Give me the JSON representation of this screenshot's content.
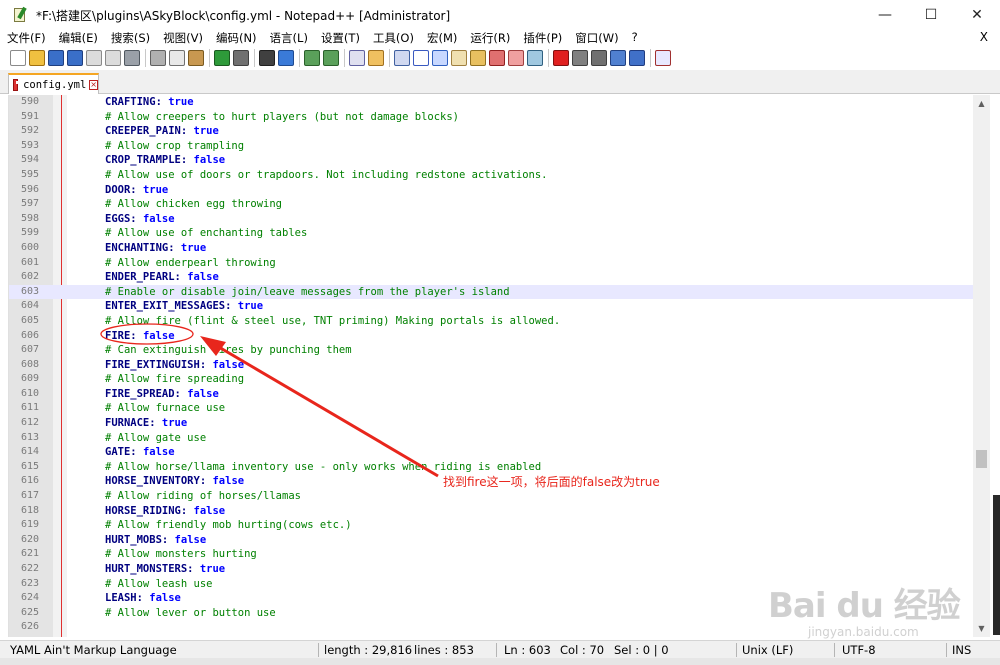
{
  "window": {
    "title": "*F:\\搭建区\\plugins\\ASkyBlock\\config.yml - Notepad++ [Administrator]",
    "controls": {
      "minimize": "—",
      "maximize": "☐",
      "close": "✕"
    }
  },
  "menu": {
    "items": [
      "文件(F)",
      "编辑(E)",
      "搜索(S)",
      "视图(V)",
      "编码(N)",
      "语言(L)",
      "设置(T)",
      "工具(O)",
      "宏(M)",
      "运行(R)",
      "插件(P)",
      "窗口(W)",
      "?"
    ],
    "close_doc": "X"
  },
  "toolbar": {
    "buttons": [
      {
        "name": "new-file-icon",
        "color": "#ffffff",
        "border": "#8a8a8a"
      },
      {
        "name": "open-file-icon",
        "color": "#f0c040",
        "border": "#a07010"
      },
      {
        "name": "save-icon",
        "color": "#3a6fc8",
        "border": "#1f3f80"
      },
      {
        "name": "save-all-icon",
        "color": "#3a6fc8",
        "border": "#1f3f80"
      },
      {
        "name": "close-file-icon",
        "color": "#dcdcdc",
        "border": "#8a8a8a"
      },
      {
        "name": "close-all-icon",
        "color": "#dcdcdc",
        "border": "#8a8a8a"
      },
      {
        "name": "print-icon",
        "color": "#9aa0a8",
        "border": "#505860"
      },
      {
        "sep": true
      },
      {
        "name": "cut-icon",
        "color": "#b0b0b0",
        "border": "#606060"
      },
      {
        "name": "copy-icon",
        "color": "#e8e8e8",
        "border": "#707070"
      },
      {
        "name": "paste-icon",
        "color": "#c89850",
        "border": "#7a5a20"
      },
      {
        "sep": true
      },
      {
        "name": "undo-icon",
        "color": "#2e9a3a",
        "border": "#1a5a20"
      },
      {
        "name": "redo-icon",
        "color": "#707070",
        "border": "#404040"
      },
      {
        "sep": true
      },
      {
        "name": "find-icon",
        "color": "#404040",
        "border": "#202020"
      },
      {
        "name": "replace-icon",
        "color": "#3a7ad8",
        "border": "#1f4a90"
      },
      {
        "sep": true
      },
      {
        "name": "zoom-in-icon",
        "color": "#5aa05a",
        "border": "#2a602a"
      },
      {
        "name": "zoom-out-icon",
        "color": "#5aa05a",
        "border": "#2a602a"
      },
      {
        "sep": true
      },
      {
        "name": "sync-vertical-icon",
        "color": "#e0e0f0",
        "border": "#6060a0"
      },
      {
        "name": "sync-horizontal-icon",
        "color": "#f0c060",
        "border": "#a07020"
      },
      {
        "sep": true
      },
      {
        "name": "word-wrap-icon",
        "color": "#d0d8f0",
        "border": "#4060a0"
      },
      {
        "name": "show-all-chars-icon",
        "color": "#ffffff",
        "border": "#3a5ac0"
      },
      {
        "name": "indent-guide-icon",
        "color": "#c8d8ff",
        "border": "#3060c0"
      },
      {
        "name": "udl-icon",
        "color": "#f0e0b0",
        "border": "#a08040"
      },
      {
        "name": "doc-map-icon",
        "color": "#e8c060",
        "border": "#907020"
      },
      {
        "name": "function-list-icon",
        "color": "#e07070",
        "border": "#902020"
      },
      {
        "name": "folder-workspace-icon",
        "color": "#f0a0a0",
        "border": "#a04040"
      },
      {
        "name": "monitoring-icon",
        "color": "#a0c8e0",
        "border": "#306080"
      },
      {
        "sep": true
      },
      {
        "name": "record-macro-icon",
        "color": "#e02020",
        "border": "#801010"
      },
      {
        "name": "stop-record-icon",
        "color": "#808080",
        "border": "#404040"
      },
      {
        "name": "play-macro-icon",
        "color": "#707070",
        "border": "#404040"
      },
      {
        "name": "play-multiple-icon",
        "color": "#5080d0",
        "border": "#204080"
      },
      {
        "name": "save-macro-icon",
        "color": "#4070c8",
        "border": "#203c80"
      },
      {
        "sep": true
      },
      {
        "name": "spellcheck-icon",
        "color": "#e8e8ff",
        "border": "#a03030"
      }
    ]
  },
  "tab": {
    "label": "config.yml",
    "close": "×"
  },
  "editor": {
    "lines": [
      {
        "n": "590",
        "type": "kv",
        "key": "CRAFTING:",
        "val": "true"
      },
      {
        "n": "591",
        "type": "comment",
        "text": "# Allow creepers to hurt players (but not damage blocks)"
      },
      {
        "n": "592",
        "type": "kv",
        "key": "CREEPER_PAIN:",
        "val": "true"
      },
      {
        "n": "593",
        "type": "comment",
        "text": "# Allow crop trampling"
      },
      {
        "n": "594",
        "type": "kv",
        "key": "CROP_TRAMPLE:",
        "val": "false"
      },
      {
        "n": "595",
        "type": "comment",
        "text": "# Allow use of doors or trapdoors. Not including redstone activations."
      },
      {
        "n": "596",
        "type": "kv",
        "key": "DOOR:",
        "val": "true"
      },
      {
        "n": "597",
        "type": "comment",
        "text": "# Allow chicken egg throwing"
      },
      {
        "n": "598",
        "type": "kv",
        "key": "EGGS:",
        "val": "false"
      },
      {
        "n": "599",
        "type": "comment",
        "text": "# Allow use of enchanting tables"
      },
      {
        "n": "600",
        "type": "kv",
        "key": "ENCHANTING:",
        "val": "true"
      },
      {
        "n": "601",
        "type": "comment",
        "text": "# Allow enderpearl throwing"
      },
      {
        "n": "602",
        "type": "kv",
        "key": "ENDER_PEARL:",
        "val": "false"
      },
      {
        "n": "603",
        "type": "comment",
        "text": "# Enable or disable join/leave messages from the player's island",
        "current": true
      },
      {
        "n": "604",
        "type": "kv",
        "key": "ENTER_EXIT_MESSAGES:",
        "val": "true"
      },
      {
        "n": "605",
        "type": "comment",
        "text": "# Allow fire (flint & steel use, TNT priming) Making portals is allowed."
      },
      {
        "n": "606",
        "type": "kv",
        "key": "FIRE:",
        "val": "false"
      },
      {
        "n": "607",
        "type": "comment",
        "text": "# Can extinguish fires by punching them"
      },
      {
        "n": "608",
        "type": "kv",
        "key": "FIRE_EXTINGUISH:",
        "val": "false"
      },
      {
        "n": "609",
        "type": "comment",
        "text": "# Allow fire spreading"
      },
      {
        "n": "610",
        "type": "kv",
        "key": "FIRE_SPREAD:",
        "val": "false"
      },
      {
        "n": "611",
        "type": "comment",
        "text": "# Allow furnace use"
      },
      {
        "n": "612",
        "type": "kv",
        "key": "FURNACE:",
        "val": "true"
      },
      {
        "n": "613",
        "type": "comment",
        "text": "# Allow gate use"
      },
      {
        "n": "614",
        "type": "kv",
        "key": "GATE:",
        "val": "false"
      },
      {
        "n": "615",
        "type": "comment",
        "text": "# Allow horse/llama inventory use - only works when riding is enabled"
      },
      {
        "n": "616",
        "type": "kv",
        "key": "HORSE_INVENTORY:",
        "val": "false"
      },
      {
        "n": "617",
        "type": "comment",
        "text": "# Allow riding of horses/llamas"
      },
      {
        "n": "618",
        "type": "kv",
        "key": "HORSE_RIDING:",
        "val": "false"
      },
      {
        "n": "619",
        "type": "comment",
        "text": "# Allow friendly mob hurting(cows etc.)"
      },
      {
        "n": "620",
        "type": "kv",
        "key": "HURT_MOBS:",
        "val": "false"
      },
      {
        "n": "621",
        "type": "comment",
        "text": "# Allow monsters hurting"
      },
      {
        "n": "622",
        "type": "kv",
        "key": "HURT_MONSTERS:",
        "val": "true"
      },
      {
        "n": "623",
        "type": "comment",
        "text": "# Allow leash use"
      },
      {
        "n": "624",
        "type": "kv",
        "key": "LEASH:",
        "val": "false"
      },
      {
        "n": "625",
        "type": "comment",
        "text": "# Allow lever or button use"
      },
      {
        "n": "626",
        "type": "kv",
        "key": "",
        "val": ""
      }
    ]
  },
  "annotation": {
    "text": "找到fire这一项，将后面的false改为true",
    "color": "#e8261c"
  },
  "statusbar": {
    "language": "YAML Ain't Markup Language",
    "length": "length : 29,816",
    "lines": "lines : 853",
    "ln": "Ln : 603",
    "col": "Col : 70",
    "sel": "Sel : 0 | 0",
    "eol": "Unix (LF)",
    "encoding": "UTF-8",
    "mode": "INS"
  },
  "watermark": {
    "logo": "Bai du 经验",
    "sub": "jingyan.baidu.com"
  }
}
